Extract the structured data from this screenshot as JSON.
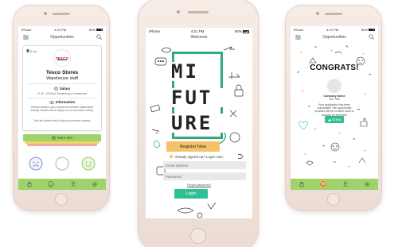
{
  "colors": {
    "green": "#9ed26a",
    "teal": "#2fbf94",
    "yellow": "#f5c267",
    "pink": "#f4a9a0"
  },
  "status": {
    "carrier": "iPhone",
    "time": "4:21 PM",
    "battery": "80%"
  },
  "left_screen": {
    "title": "Opportunities",
    "menu_icon": "filter-sliders-icon",
    "search_icon": "search-icon",
    "distance": "0 mi",
    "logo_text": "TESCO",
    "company": "Tesco Stores",
    "role": "Warehouse staff",
    "salary_title": "Salary",
    "salary_text": "£7.40 - £9.00/ph Depending on experience",
    "info_title": "Information",
    "info_text_1": "Veniam vestibul, quis nostrud exercitation ullamcorper suscipit lobortis nisl ut aliquip ex ea commodo conseq.",
    "info_text_2": "Duis leo lobortis nisl ut aliq ea commodo conseq.",
    "more_info_label": "More Info",
    "tabs": [
      "hand-icon",
      "smile-icon",
      "person-icon",
      "gear-icon"
    ]
  },
  "middle_screen": {
    "welcome": "Welcome",
    "logo_line1": "MI",
    "logo_line2": "FUT",
    "logo_line3": "URE",
    "register_label": "Register Now",
    "already_text": "Already signed up? Login now:",
    "email_placeholder": "Email address",
    "password_placeholder": "Password",
    "forgot_label": "Forgot password?",
    "login_label": "Login"
  },
  "right_screen": {
    "title": "Opportunities",
    "congrats": "CONGRATS!",
    "company_name": "Company Name",
    "job_title": "Job Title",
    "message": "Your application has been successful! The opportunity provider will be in touch soon to arrange an interview.",
    "great_label": "Great"
  }
}
